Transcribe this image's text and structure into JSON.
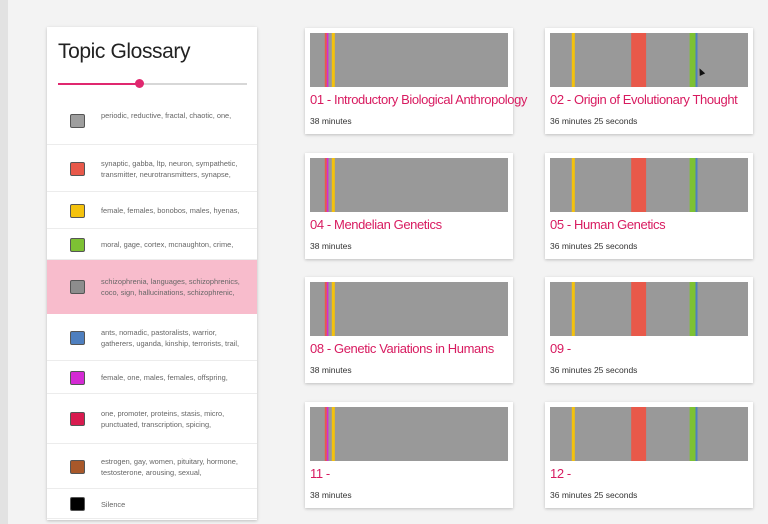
{
  "glossary": {
    "title": "Topic Glossary",
    "slider_value": 0.43,
    "topics": [
      {
        "color": "#9e9e9e",
        "words": "periodic, reductive, fractal, chaotic, one,",
        "highlight": false
      },
      {
        "color": "#e8594a",
        "words": "synaptic, gabba, ltp, neuron, sympathetic, transmitter, neurotransmitters, synapse,",
        "highlight": false
      },
      {
        "color": "#f4c20d",
        "words": "female, females, bonobos, males, hyenas,",
        "highlight": false
      },
      {
        "color": "#7dc133",
        "words": "moral, gage, cortex, mcnaughton, crime,",
        "highlight": false
      },
      {
        "color": "#8d8d8d",
        "words": "schizophrenia, languages, schizophrenics, coco, sign, hallucinations, schizophrenic,",
        "highlight": true
      },
      {
        "color": "#4e7fbf",
        "words": "ants, nomadic, pastoralists, warrior, gatherers, uganda, kinship, terrorists, trail,",
        "highlight": false
      },
      {
        "color": "#d42ad4",
        "words": "female, one, males, females, offspring,",
        "highlight": false
      },
      {
        "color": "#d81b4f",
        "words": "one, promoter, proteins, stasis, micro, punctuated, transcription, spicing,",
        "highlight": false
      },
      {
        "color": "#a8582a",
        "words": "estrogen, gay, women, pituitary, hormone, testosterone, arousing, sexual,",
        "highlight": false
      },
      {
        "color": "#000000",
        "words": "Silence",
        "highlight": false
      }
    ]
  },
  "lectures": [
    {
      "title": "01 - Introductory Biological Anthropology",
      "duration": "38 minutes",
      "pattern": "A"
    },
    {
      "title": "02 - Origin of Evolutionary Thought",
      "duration": "36 minutes 25 seconds",
      "pattern": "B"
    },
    {
      "title": "04 - Mendelian Genetics",
      "duration": "38 minutes",
      "pattern": "A"
    },
    {
      "title": "05 - Human Genetics",
      "duration": "36 minutes 25 seconds",
      "pattern": "B"
    },
    {
      "title": "08 - Genetic Variations in Humans",
      "duration": "38 minutes",
      "pattern": "A"
    },
    {
      "title": "09 -",
      "duration": "36 minutes 25 seconds",
      "pattern": "B"
    },
    {
      "title": "11 -",
      "duration": "38 minutes",
      "pattern": "A"
    },
    {
      "title": "12 -",
      "duration": "36 minutes 25 seconds",
      "pattern": "B"
    }
  ],
  "timeline_patterns": {
    "A": {
      "base": "#999999",
      "bands": [
        {
          "start": 0.075,
          "end": 0.085,
          "color": "#e8594a"
        },
        {
          "start": 0.085,
          "end": 0.093,
          "color": "#d42ad4"
        },
        {
          "start": 0.11,
          "end": 0.125,
          "color": "#f4c20d"
        }
      ]
    },
    "B": {
      "base": "#999999",
      "bands": [
        {
          "start": 0.11,
          "end": 0.125,
          "color": "#f4c20d"
        },
        {
          "start": 0.41,
          "end": 0.485,
          "color": "#e8594a"
        },
        {
          "start": 0.705,
          "end": 0.735,
          "color": "#7dc133"
        },
        {
          "start": 0.735,
          "end": 0.745,
          "color": "#4e7fbf"
        }
      ]
    }
  }
}
